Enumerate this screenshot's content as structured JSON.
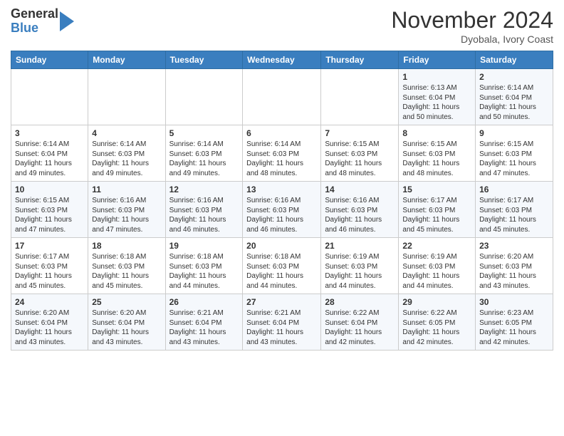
{
  "header": {
    "logo_general": "General",
    "logo_blue": "Blue",
    "month_title": "November 2024",
    "location": "Dyobala, Ivory Coast"
  },
  "days_of_week": [
    "Sunday",
    "Monday",
    "Tuesday",
    "Wednesday",
    "Thursday",
    "Friday",
    "Saturday"
  ],
  "weeks": [
    [
      {
        "day": "",
        "info": ""
      },
      {
        "day": "",
        "info": ""
      },
      {
        "day": "",
        "info": ""
      },
      {
        "day": "",
        "info": ""
      },
      {
        "day": "",
        "info": ""
      },
      {
        "day": "1",
        "info": "Sunrise: 6:13 AM\nSunset: 6:04 PM\nDaylight: 11 hours and 50 minutes."
      },
      {
        "day": "2",
        "info": "Sunrise: 6:14 AM\nSunset: 6:04 PM\nDaylight: 11 hours and 50 minutes."
      }
    ],
    [
      {
        "day": "3",
        "info": "Sunrise: 6:14 AM\nSunset: 6:04 PM\nDaylight: 11 hours and 49 minutes."
      },
      {
        "day": "4",
        "info": "Sunrise: 6:14 AM\nSunset: 6:03 PM\nDaylight: 11 hours and 49 minutes."
      },
      {
        "day": "5",
        "info": "Sunrise: 6:14 AM\nSunset: 6:03 PM\nDaylight: 11 hours and 49 minutes."
      },
      {
        "day": "6",
        "info": "Sunrise: 6:14 AM\nSunset: 6:03 PM\nDaylight: 11 hours and 48 minutes."
      },
      {
        "day": "7",
        "info": "Sunrise: 6:15 AM\nSunset: 6:03 PM\nDaylight: 11 hours and 48 minutes."
      },
      {
        "day": "8",
        "info": "Sunrise: 6:15 AM\nSunset: 6:03 PM\nDaylight: 11 hours and 48 minutes."
      },
      {
        "day": "9",
        "info": "Sunrise: 6:15 AM\nSunset: 6:03 PM\nDaylight: 11 hours and 47 minutes."
      }
    ],
    [
      {
        "day": "10",
        "info": "Sunrise: 6:15 AM\nSunset: 6:03 PM\nDaylight: 11 hours and 47 minutes."
      },
      {
        "day": "11",
        "info": "Sunrise: 6:16 AM\nSunset: 6:03 PM\nDaylight: 11 hours and 47 minutes."
      },
      {
        "day": "12",
        "info": "Sunrise: 6:16 AM\nSunset: 6:03 PM\nDaylight: 11 hours and 46 minutes."
      },
      {
        "day": "13",
        "info": "Sunrise: 6:16 AM\nSunset: 6:03 PM\nDaylight: 11 hours and 46 minutes."
      },
      {
        "day": "14",
        "info": "Sunrise: 6:16 AM\nSunset: 6:03 PM\nDaylight: 11 hours and 46 minutes."
      },
      {
        "day": "15",
        "info": "Sunrise: 6:17 AM\nSunset: 6:03 PM\nDaylight: 11 hours and 45 minutes."
      },
      {
        "day": "16",
        "info": "Sunrise: 6:17 AM\nSunset: 6:03 PM\nDaylight: 11 hours and 45 minutes."
      }
    ],
    [
      {
        "day": "17",
        "info": "Sunrise: 6:17 AM\nSunset: 6:03 PM\nDaylight: 11 hours and 45 minutes."
      },
      {
        "day": "18",
        "info": "Sunrise: 6:18 AM\nSunset: 6:03 PM\nDaylight: 11 hours and 45 minutes."
      },
      {
        "day": "19",
        "info": "Sunrise: 6:18 AM\nSunset: 6:03 PM\nDaylight: 11 hours and 44 minutes."
      },
      {
        "day": "20",
        "info": "Sunrise: 6:18 AM\nSunset: 6:03 PM\nDaylight: 11 hours and 44 minutes."
      },
      {
        "day": "21",
        "info": "Sunrise: 6:19 AM\nSunset: 6:03 PM\nDaylight: 11 hours and 44 minutes."
      },
      {
        "day": "22",
        "info": "Sunrise: 6:19 AM\nSunset: 6:03 PM\nDaylight: 11 hours and 44 minutes."
      },
      {
        "day": "23",
        "info": "Sunrise: 6:20 AM\nSunset: 6:03 PM\nDaylight: 11 hours and 43 minutes."
      }
    ],
    [
      {
        "day": "24",
        "info": "Sunrise: 6:20 AM\nSunset: 6:04 PM\nDaylight: 11 hours and 43 minutes."
      },
      {
        "day": "25",
        "info": "Sunrise: 6:20 AM\nSunset: 6:04 PM\nDaylight: 11 hours and 43 minutes."
      },
      {
        "day": "26",
        "info": "Sunrise: 6:21 AM\nSunset: 6:04 PM\nDaylight: 11 hours and 43 minutes."
      },
      {
        "day": "27",
        "info": "Sunrise: 6:21 AM\nSunset: 6:04 PM\nDaylight: 11 hours and 43 minutes."
      },
      {
        "day": "28",
        "info": "Sunrise: 6:22 AM\nSunset: 6:04 PM\nDaylight: 11 hours and 42 minutes."
      },
      {
        "day": "29",
        "info": "Sunrise: 6:22 AM\nSunset: 6:05 PM\nDaylight: 11 hours and 42 minutes."
      },
      {
        "day": "30",
        "info": "Sunrise: 6:23 AM\nSunset: 6:05 PM\nDaylight: 11 hours and 42 minutes."
      }
    ]
  ]
}
